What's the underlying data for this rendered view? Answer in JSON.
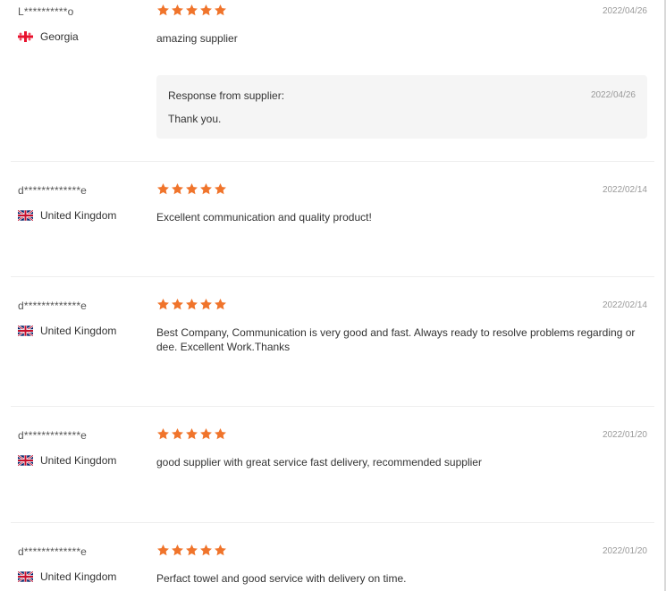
{
  "colors": {
    "star": "#f0742b",
    "divider": "#eeeeee",
    "response_bg": "#f5f5f5"
  },
  "reviews": [
    {
      "user": "L**********o",
      "country": "Georgia",
      "flag_icon": "georgia-flag-icon",
      "rating": 5,
      "date": "2022/04/26",
      "comment": "amazing supplier",
      "response": {
        "title": "Response from supplier:",
        "date": "2022/04/26",
        "text": "Thank you."
      }
    },
    {
      "user": "d*************e",
      "country": "United Kingdom",
      "flag_icon": "uk-flag-icon",
      "rating": 5,
      "date": "2022/02/14",
      "comment": "Excellent communication and quality product!"
    },
    {
      "user": "d*************e",
      "country": "United Kingdom",
      "flag_icon": "uk-flag-icon",
      "rating": 5,
      "date": "2022/02/14",
      "comment": "Best Company, Communication is very good and fast. Always ready to resolve problems regarding or dee. Excellent Work.Thanks"
    },
    {
      "user": "d*************e",
      "country": "United Kingdom",
      "flag_icon": "uk-flag-icon",
      "rating": 5,
      "date": "2022/01/20",
      "comment": "good supplier with great service fast delivery, recommended supplier"
    },
    {
      "user": "d*************e",
      "country": "United Kingdom",
      "flag_icon": "uk-flag-icon",
      "rating": 5,
      "date": "2022/01/20",
      "comment": "Perfact towel and good service with delivery on time."
    }
  ]
}
